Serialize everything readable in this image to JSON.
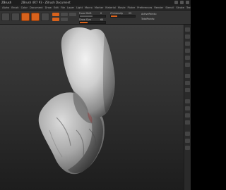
{
  "title_bar": {
    "app": "ZBrush",
    "title": "ZBrush 4R7 P3 · ZBrush Document",
    "controls": [
      "minimize",
      "maximize",
      "close"
    ]
  },
  "menu": [
    "Alpha",
    "Brush",
    "Color",
    "Document",
    "Draw",
    "Edit",
    "File",
    "Layer",
    "Light",
    "Macro",
    "Marker",
    "Material",
    "Movie",
    "Picker",
    "Preferences",
    "Render",
    "Stencil",
    "Stroke",
    "Texture",
    "Tool",
    "Transform",
    "Zplugin",
    "Zscript"
  ],
  "toolbar": {
    "focal_label": "Focal Shift",
    "focal_value": "0",
    "draw_size_label": "Draw Size",
    "draw_size_value": "64",
    "z_intensity_label": "Z Intensity",
    "z_intensity_value": "25",
    "active_points_label": "ActivePoints:",
    "total_points_label": "TotalPoints:"
  },
  "accent_color": "#d8621c",
  "viewport": {
    "background_top": "#3e3e3e",
    "background_bottom": "#1d1d1d",
    "model_color": "#c8c8c8"
  }
}
